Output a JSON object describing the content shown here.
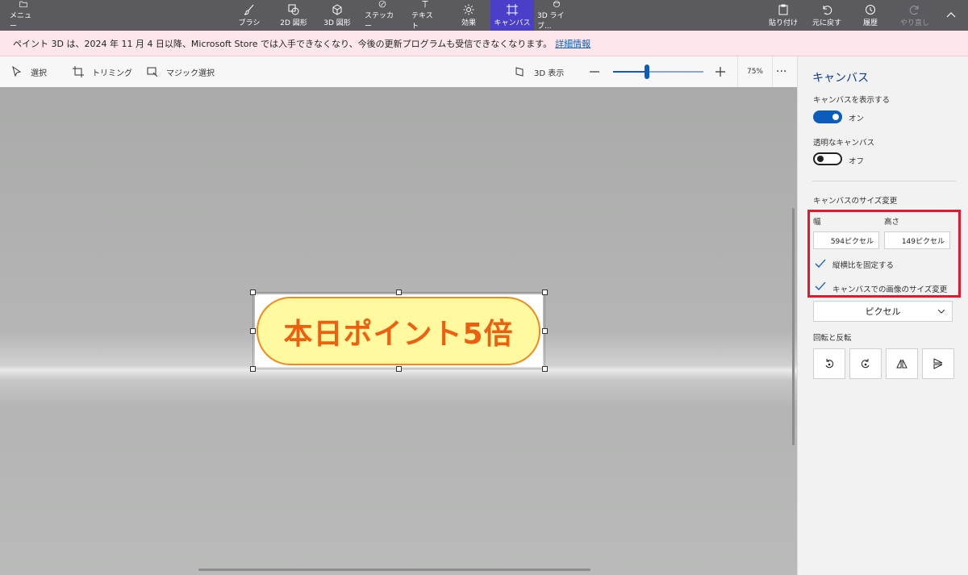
{
  "toolbar": {
    "menu": "メニュー",
    "tools": [
      {
        "label": "ブラシ",
        "icon": "brush-icon"
      },
      {
        "label": "2D 図形",
        "icon": "2d-shapes-icon"
      },
      {
        "label": "3D 図形",
        "icon": "3d-shapes-icon"
      },
      {
        "label": "ステッカー",
        "icon": "sticker-icon"
      },
      {
        "label": "テキスト",
        "icon": "text-icon"
      },
      {
        "label": "効果",
        "icon": "effects-icon"
      },
      {
        "label": "キャンバス",
        "icon": "canvas-icon",
        "active": true
      },
      {
        "label": "3D ライブ...",
        "icon": "3d-library-icon"
      }
    ],
    "paste": "貼り付け",
    "undo": "元に戻す",
    "history": "履歴",
    "redo": "やり直し",
    "active_color": "#4a3fc8"
  },
  "notice": {
    "text": "ペイント 3D は、2024 年 11 月 4 日以降、Microsoft Store では入手できなくなり、今後の更新プログラムも受信できなくなります。",
    "link": "詳細情報"
  },
  "subbar": {
    "select": "選択",
    "crop": "トリミング",
    "magic_select": "マジック選択",
    "view_3d": "3D 表示",
    "zoom_percent": 75,
    "zoom_text": "75%"
  },
  "canvas": {
    "banner_text": "本日ポイント5倍",
    "banner_fill": "#fff9a0",
    "banner_text_color": "#ee6010"
  },
  "panel": {
    "title": "キャンバス",
    "show_canvas_label": "キャンバスを表示する",
    "show_canvas_state": "オン",
    "transparent_label": "透明なキャンバス",
    "transparent_state": "オフ",
    "resize_label": "キャンバスのサイズ変更",
    "width_label": "幅",
    "height_label": "高さ",
    "width_value": "594ピクセル",
    "height_value": "149ピクセル",
    "lock_aspect": "縦横比を固定する",
    "resize_image": "キャンバスでの画像のサイズ変更",
    "unit": "ピクセル",
    "rotate_label": "回転と反転",
    "highlight_color": "#e3182d"
  }
}
